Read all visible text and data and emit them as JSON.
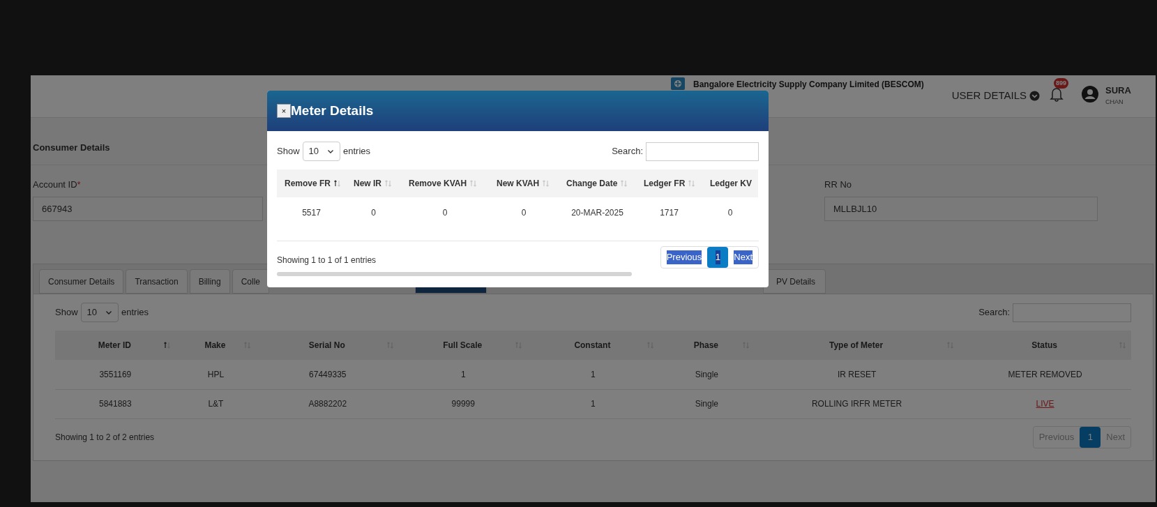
{
  "header": {
    "company": "Bangalore Electricity Supply Company Limited (BESCOM)",
    "user_menu": "USER DETAILS",
    "notification_count": "899",
    "user_name": "SURA",
    "user_role": "CHAN"
  },
  "consumer_section": {
    "title": "Consumer Details",
    "fields": [
      {
        "label": "Account ID",
        "required": true,
        "required_mark": "*",
        "value": "667943"
      },
      {
        "label": "RR No",
        "value": "MLLBJL10"
      }
    ]
  },
  "tabs": [
    {
      "label": "Consumer Details",
      "selected": false
    },
    {
      "label": "Transaction",
      "selected": false
    },
    {
      "label": "Billing",
      "selected": false
    },
    {
      "label": "Colle",
      "selected": false
    },
    {
      "selected": true
    },
    {
      "label": "PV Details",
      "selected": false
    }
  ],
  "meters_table": {
    "show_label": "Show",
    "page_length": "10",
    "entries_label": "entries",
    "search_label": "Search:",
    "columns": [
      {
        "label": "Meter ID",
        "sorted": true
      },
      {
        "label": "Make",
        "sorted": false
      },
      {
        "label": "Serial No",
        "sorted": false
      },
      {
        "label": "Full Scale",
        "sorted": false
      },
      {
        "label": "Constant",
        "sorted": false
      },
      {
        "label": "Phase",
        "sorted": false
      },
      {
        "label": "Type of Meter",
        "sorted": false
      },
      {
        "label": "Status",
        "sorted": false
      }
    ],
    "rows": [
      {
        "cells": [
          "3551169",
          "HPL",
          "67449335",
          "1",
          "1",
          "Single",
          "IR RESET"
        ],
        "status": {
          "text": "METER REMOVED",
          "kind": "text"
        }
      },
      {
        "cells": [
          "5841883",
          "L&T",
          "A8882202",
          "99999",
          "1",
          "Single",
          "ROLLING IRFR METER"
        ],
        "status": {
          "text": "LIVE",
          "kind": "link"
        }
      }
    ],
    "info": "Showing 1 to 2 of 2 entries",
    "pagination": [
      {
        "label": "Previous",
        "kind": "nav",
        "selected": false,
        "disabled": true,
        "text_selected": false
      },
      {
        "label": "1",
        "kind": "page",
        "selected": true,
        "disabled": false,
        "text_selected": false
      },
      {
        "label": "Next",
        "kind": "nav",
        "selected": false,
        "disabled": true,
        "text_selected": false
      }
    ]
  },
  "modal": {
    "close": "×",
    "title": "Meter Details",
    "show_label": "Show",
    "page_length": "10",
    "entries_label": "entries",
    "search_label": "Search:",
    "columns": [
      {
        "label": "Remove FR",
        "sorted": true
      },
      {
        "label": "New IR",
        "sorted": false
      },
      {
        "label": "Remove KVAH",
        "sorted": false
      },
      {
        "label": "New KVAH",
        "sorted": false
      },
      {
        "label": "Change Date",
        "sorted": false
      },
      {
        "label": "Ledger FR",
        "sorted": false
      },
      {
        "label": "Ledger KV"
      }
    ],
    "rows": [
      {
        "cells": [
          "5517",
          "0",
          "0",
          "0",
          "20-MAR-2025",
          "1717",
          "0"
        ]
      }
    ],
    "info": "Showing 1 to 1 of 1 entries",
    "pagination": [
      {
        "label": "Previous",
        "kind": "nav",
        "selected": false,
        "text_selected": true
      },
      {
        "label": "1",
        "kind": "page",
        "selected": true,
        "text_selected": true
      },
      {
        "label": "Next",
        "kind": "nav",
        "selected": false,
        "text_selected": true
      }
    ]
  }
}
